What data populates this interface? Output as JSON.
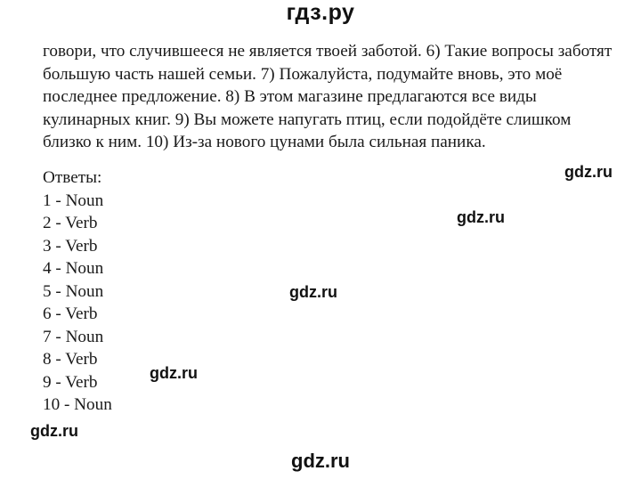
{
  "header": {
    "site_title": "гдз.ру"
  },
  "text": {
    "lines": [
      "говори, что случившееся не является твоей заботой. 6) Такие вопросы заботят",
      "большую часть нашей семьи. 7) Пожалуйста, подумайте вновь, это моё",
      "последнее предложение. 8) В этом магазине предлагаются все виды",
      "кулинарных книг. 9) Вы можете напугать птиц, если подойдёте слишком",
      "близко к ним. 10) Из-за нового цунами была сильная паника."
    ]
  },
  "answers": {
    "heading": "Ответы:",
    "items": [
      "1 - Noun",
      "2 - Verb",
      "3 - Verb",
      "4 - Noun",
      "5 - Noun",
      "6 - Verb",
      "7 - Noun",
      "8 - Verb",
      "9 - Verb",
      "10 - Noun"
    ]
  },
  "watermarks": {
    "label": "gdz.ru",
    "footer": "gdz.ru"
  }
}
